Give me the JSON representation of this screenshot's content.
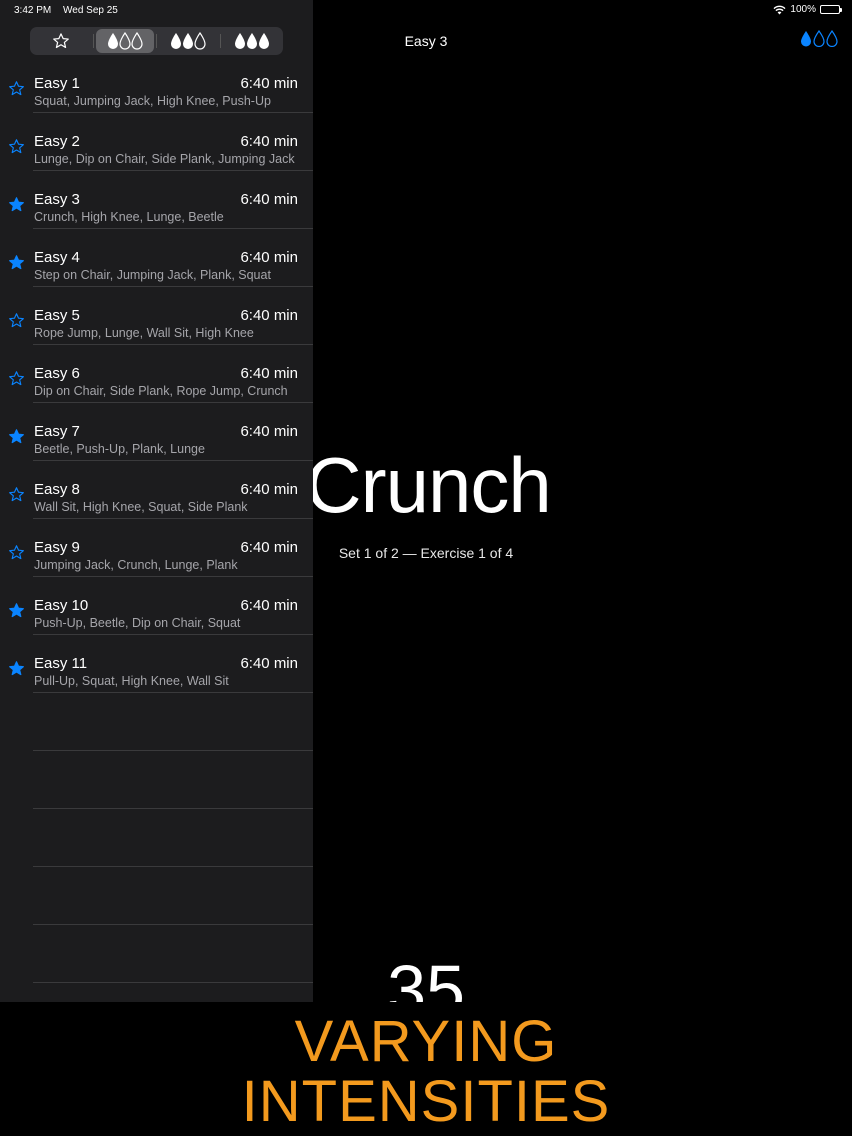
{
  "status_bar": {
    "time": "3:42 PM",
    "date": "Wed Sep 25",
    "battery": "100%"
  },
  "filter": {
    "options": [
      {
        "icon": "star-outline-icon"
      },
      {
        "icon": "one-drop-icon",
        "active": true
      },
      {
        "icon": "two-drops-icon"
      },
      {
        "icon": "three-drops-icon"
      }
    ]
  },
  "workouts": [
    {
      "name": "Easy 1",
      "duration": "6:40 min",
      "exercises": "Squat, Jumping Jack, High Knee, Push-Up",
      "favorite": false
    },
    {
      "name": "Easy 2",
      "duration": "6:40 min",
      "exercises": "Lunge, Dip on Chair, Side Plank, Jumping Jack",
      "favorite": false
    },
    {
      "name": "Easy 3",
      "duration": "6:40 min",
      "exercises": "Crunch, High Knee, Lunge, Beetle",
      "favorite": true
    },
    {
      "name": "Easy 4",
      "duration": "6:40 min",
      "exercises": "Step on Chair, Jumping Jack, Plank, Squat",
      "favorite": true
    },
    {
      "name": "Easy 5",
      "duration": "6:40 min",
      "exercises": "Rope Jump, Lunge, Wall Sit, High Knee",
      "favorite": false
    },
    {
      "name": "Easy 6",
      "duration": "6:40 min",
      "exercises": "Dip on Chair, Side Plank, Rope Jump, Crunch",
      "favorite": false
    },
    {
      "name": "Easy 7",
      "duration": "6:40 min",
      "exercises": "Beetle, Push-Up, Plank, Lunge",
      "favorite": true
    },
    {
      "name": "Easy 8",
      "duration": "6:40 min",
      "exercises": "Wall Sit, High Knee, Squat, Side Plank",
      "favorite": false
    },
    {
      "name": "Easy 9",
      "duration": "6:40 min",
      "exercises": "Jumping Jack, Crunch, Lunge, Plank",
      "favorite": false
    },
    {
      "name": "Easy 10",
      "duration": "6:40 min",
      "exercises": "Push-Up, Beetle, Dip on Chair, Squat",
      "favorite": true
    },
    {
      "name": "Easy 11",
      "duration": "6:40 min",
      "exercises": "Pull-Up, Squat, High Knee, Wall Sit",
      "favorite": true
    }
  ],
  "detail": {
    "title": "Easy 3",
    "intensity_icon": "one-of-three-drops-icon",
    "exercise": "Crunch",
    "set_info": "Set 1 of 2 — Exercise 1 of 4",
    "countdown": "35"
  },
  "banner": {
    "line1": "VARYING",
    "line2": "INTENSITIES"
  },
  "colors": {
    "accent": "#0a84ff",
    "banner": "#f39a1e",
    "sidebar": "#1c1c1e"
  }
}
